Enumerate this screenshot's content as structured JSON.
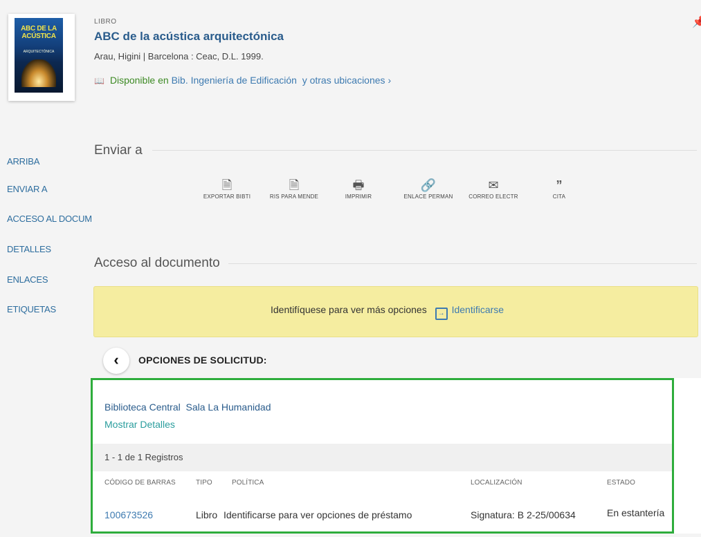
{
  "record": {
    "type_label": "LIBRO",
    "title": "ABC de la acústica arquitectónica",
    "author_line": "Arau, Higini | Barcelona : Ceac, D.L. 1999.",
    "availability_prefix": "Disponible en",
    "availability_location": "Bib. Ingeniería de Edificación",
    "availability_more": "y otras ubicaciones",
    "cover_text": "ABC DE LA ACÚSTICA ARQUITECTÓNICA"
  },
  "sidebar": {
    "items": [
      {
        "label": "ARRIBA"
      },
      {
        "label": "ENVIAR A"
      },
      {
        "label": "ACCESO AL DOCUM"
      },
      {
        "label": "DETALLES"
      },
      {
        "label": "ENLACES"
      },
      {
        "label": "ETIQUETAS"
      }
    ]
  },
  "send_to": {
    "title": "Enviar a",
    "actions": [
      {
        "label": "EXPORTAR BIBTI",
        "icon": "file-export-icon"
      },
      {
        "label": "RIS PARA MENDE",
        "icon": "file-export-icon"
      },
      {
        "label": "IMPRIMIR",
        "icon": "printer-icon"
      },
      {
        "label": "ENLACE PERMAN",
        "icon": "link-icon"
      },
      {
        "label": "CORREO ELECTR",
        "icon": "envelope-icon"
      },
      {
        "label": "CITA",
        "icon": "quote-icon"
      }
    ]
  },
  "access": {
    "title": "Acceso al documento",
    "notice_text": "Identifíquese para ver más opciones",
    "login_label": "Identificarse",
    "options_label": "OPCIONES DE SOLICITUD:"
  },
  "holdings": {
    "library": "Biblioteca Central  Sala La Humanidad",
    "show_details": "Mostrar Detalles",
    "records_count": "1 - 1 de 1 Registros",
    "columns": [
      "CÓDIGO DE BARRAS",
      "TIPO",
      "POLÍTICA",
      "LOCALIZACIÓN",
      "ESTADO"
    ],
    "rows": [
      {
        "barcode": "100673526",
        "type": "Libro",
        "policy": "Identificarse para ver opciones de préstamo",
        "location": "Signatura: B 2-25/00634",
        "status": "En estantería"
      }
    ]
  },
  "colors": {
    "link": "#3d7ab0",
    "highlight_border": "#2ead3c",
    "notice_bg": "#f5eda0",
    "available": "#3d8a24"
  }
}
